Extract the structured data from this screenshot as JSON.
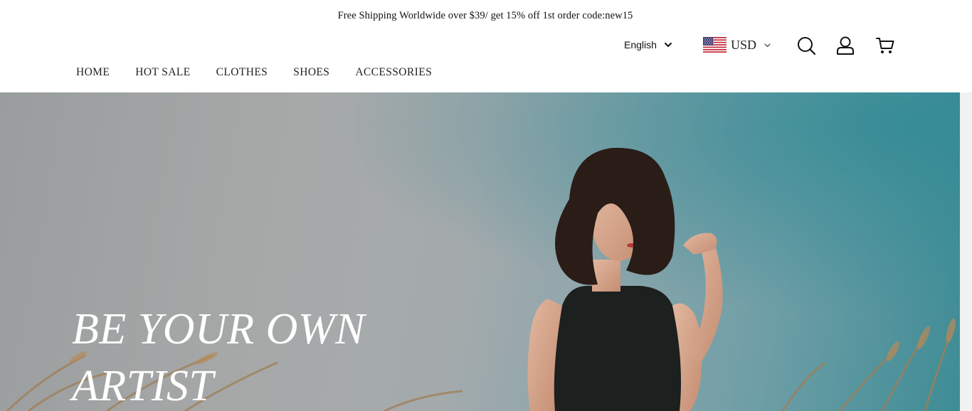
{
  "announcement": {
    "text": "Free Shipping Worldwide over $39/ get 15% off 1st order code:new15"
  },
  "nav": {
    "items": [
      {
        "label": "HOME"
      },
      {
        "label": "HOT SALE"
      },
      {
        "label": "CLOTHES"
      },
      {
        "label": "SHOES"
      },
      {
        "label": "ACCESSORIES"
      }
    ]
  },
  "language": {
    "selected": "English",
    "icon": "chevron-down-icon"
  },
  "currency": {
    "selected": "USD",
    "flag": "us-flag-icon",
    "icon": "chevron-down-icon"
  },
  "header_icons": [
    {
      "name": "search-icon"
    },
    {
      "name": "account-icon"
    },
    {
      "name": "cart-icon"
    }
  ],
  "hero": {
    "title_line1": "BE YOUR OWN",
    "title_line2": "ARTIST"
  },
  "colors": {
    "text": "#222222",
    "hero_text": "#ffffff",
    "background": "#ffffff"
  }
}
